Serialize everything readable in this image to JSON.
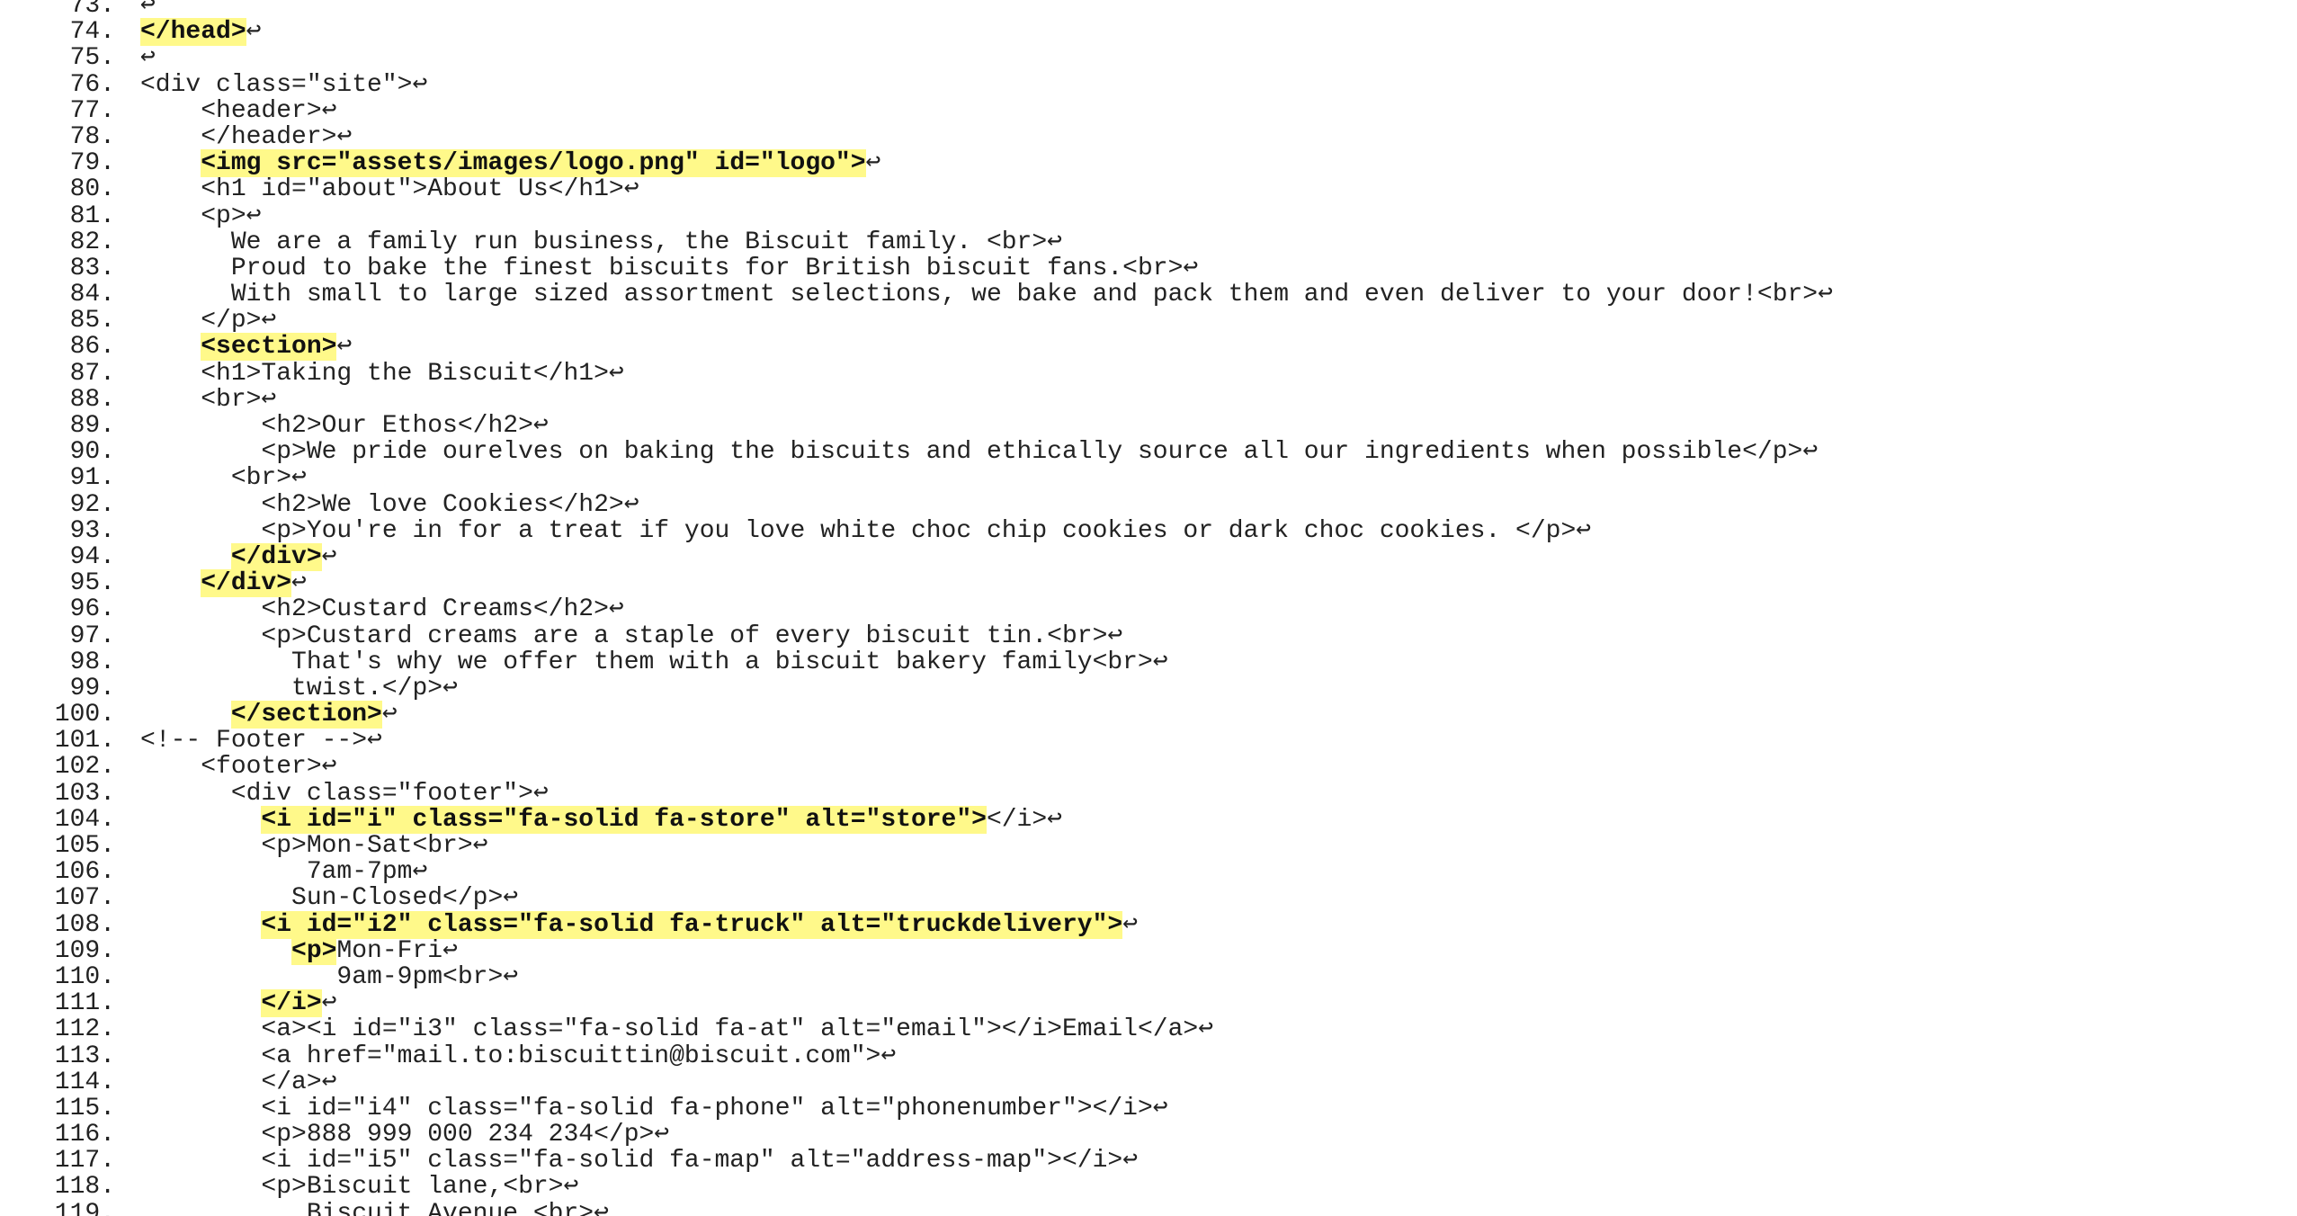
{
  "colors": {
    "background": "#ffffff",
    "text": "#222222",
    "highlight": "#fff98a"
  },
  "newline_marker": "↩",
  "lines": [
    {
      "num": "73.",
      "segments": [
        {
          "t": "",
          "hl": false
        }
      ]
    },
    {
      "num": "74.",
      "segments": [
        {
          "t": "</head>",
          "hl": true
        }
      ]
    },
    {
      "num": "75.",
      "segments": [
        {
          "t": "",
          "hl": false
        }
      ]
    },
    {
      "num": "76.",
      "segments": [
        {
          "t": "<div class=\"site\">",
          "hl": false
        }
      ]
    },
    {
      "num": "77.",
      "segments": [
        {
          "t": "    <header>",
          "hl": false
        }
      ]
    },
    {
      "num": "78.",
      "segments": [
        {
          "t": "    </header>",
          "hl": false
        }
      ]
    },
    {
      "num": "79.",
      "segments": [
        {
          "t": "    ",
          "hl": false
        },
        {
          "t": "<img src=\"assets/images/logo.png\" id=\"logo\">",
          "hl": true
        }
      ]
    },
    {
      "num": "80.",
      "segments": [
        {
          "t": "    <h1 id=\"about\">About Us</h1>",
          "hl": false
        }
      ]
    },
    {
      "num": "81.",
      "segments": [
        {
          "t": "    <p>",
          "hl": false
        }
      ]
    },
    {
      "num": "82.",
      "segments": [
        {
          "t": "      We are a family run business, the Biscuit family. <br>",
          "hl": false
        }
      ]
    },
    {
      "num": "83.",
      "segments": [
        {
          "t": "      Proud to bake the finest biscuits for British biscuit fans.<br>",
          "hl": false
        }
      ]
    },
    {
      "num": "84.",
      "segments": [
        {
          "t": "      With small to large sized assortment selections, we bake and pack them and even deliver to your door!<br>",
          "hl": false
        }
      ]
    },
    {
      "num": "85.",
      "segments": [
        {
          "t": "    </p>",
          "hl": false
        }
      ]
    },
    {
      "num": "86.",
      "segments": [
        {
          "t": "    ",
          "hl": false
        },
        {
          "t": "<section>",
          "hl": true
        }
      ]
    },
    {
      "num": "87.",
      "segments": [
        {
          "t": "    <h1>Taking the Biscuit</h1>",
          "hl": false
        }
      ]
    },
    {
      "num": "88.",
      "segments": [
        {
          "t": "    <br>",
          "hl": false
        }
      ]
    },
    {
      "num": "89.",
      "segments": [
        {
          "t": "        <h2>Our Ethos</h2>",
          "hl": false
        }
      ]
    },
    {
      "num": "90.",
      "segments": [
        {
          "t": "        <p>We pride ourelves on baking the biscuits and ethically source all our ingredients when possible</p>",
          "hl": false
        }
      ]
    },
    {
      "num": "91.",
      "segments": [
        {
          "t": "      <br>",
          "hl": false
        }
      ]
    },
    {
      "num": "92.",
      "segments": [
        {
          "t": "        <h2>We love Cookies</h2>",
          "hl": false
        }
      ]
    },
    {
      "num": "93.",
      "segments": [
        {
          "t": "        <p>You're in for a treat if you love white choc chip cookies or dark choc cookies. </p>",
          "hl": false
        }
      ]
    },
    {
      "num": "94.",
      "segments": [
        {
          "t": "      ",
          "hl": false
        },
        {
          "t": "</div>",
          "hl": true
        }
      ]
    },
    {
      "num": "95.",
      "segments": [
        {
          "t": "    ",
          "hl": false
        },
        {
          "t": "</div>",
          "hl": true
        }
      ]
    },
    {
      "num": "96.",
      "segments": [
        {
          "t": "        <h2>Custard Creams</h2>",
          "hl": false
        }
      ]
    },
    {
      "num": "97.",
      "segments": [
        {
          "t": "        <p>Custard creams are a staple of every biscuit tin.<br>",
          "hl": false
        }
      ]
    },
    {
      "num": "98.",
      "segments": [
        {
          "t": "          That's why we offer them with a biscuit bakery family<br>",
          "hl": false
        }
      ]
    },
    {
      "num": "99.",
      "segments": [
        {
          "t": "          twist.</p>",
          "hl": false
        }
      ]
    },
    {
      "num": "100.",
      "segments": [
        {
          "t": "      ",
          "hl": false
        },
        {
          "t": "</section>",
          "hl": true
        }
      ]
    },
    {
      "num": "101.",
      "segments": [
        {
          "t": "<!-- Footer -->",
          "hl": false
        }
      ]
    },
    {
      "num": "102.",
      "segments": [
        {
          "t": "    <footer>",
          "hl": false
        }
      ]
    },
    {
      "num": "103.",
      "segments": [
        {
          "t": "      <div class=\"footer\">",
          "hl": false
        }
      ]
    },
    {
      "num": "104.",
      "segments": [
        {
          "t": "        ",
          "hl": false
        },
        {
          "t": "<i id=\"i\" class=\"fa-solid fa-store\" alt=\"store\">",
          "hl": true
        },
        {
          "t": "</i>",
          "hl": false
        }
      ]
    },
    {
      "num": "105.",
      "segments": [
        {
          "t": "        <p>Mon-Sat<br>",
          "hl": false
        }
      ]
    },
    {
      "num": "106.",
      "segments": [
        {
          "t": "           7am-7pm",
          "hl": false
        }
      ]
    },
    {
      "num": "107.",
      "segments": [
        {
          "t": "          Sun-Closed</p>",
          "hl": false
        }
      ]
    },
    {
      "num": "108.",
      "segments": [
        {
          "t": "        ",
          "hl": false
        },
        {
          "t": "<i id=\"i2\" class=\"fa-solid fa-truck\" alt=\"truckdelivery\">",
          "hl": true
        }
      ]
    },
    {
      "num": "109.",
      "segments": [
        {
          "t": "          ",
          "hl": false
        },
        {
          "t": "<p>",
          "hl": true
        },
        {
          "t": "Mon-Fri",
          "hl": false
        }
      ]
    },
    {
      "num": "110.",
      "segments": [
        {
          "t": "             9am-9pm<br>",
          "hl": false
        }
      ]
    },
    {
      "num": "111.",
      "segments": [
        {
          "t": "        ",
          "hl": false
        },
        {
          "t": "</i>",
          "hl": true
        }
      ]
    },
    {
      "num": "112.",
      "segments": [
        {
          "t": "        <a><i id=\"i3\" class=\"fa-solid fa-at\" alt=\"email\"></i>Email</a>",
          "hl": false
        }
      ]
    },
    {
      "num": "113.",
      "segments": [
        {
          "t": "        <a href=\"mail.to:biscuittin@biscuit.com\">",
          "hl": false
        }
      ]
    },
    {
      "num": "114.",
      "segments": [
        {
          "t": "        </a>",
          "hl": false
        }
      ]
    },
    {
      "num": "115.",
      "segments": [
        {
          "t": "        <i id=\"i4\" class=\"fa-solid fa-phone\" alt=\"phonenumber\"></i>",
          "hl": false
        }
      ]
    },
    {
      "num": "116.",
      "segments": [
        {
          "t": "        <p>888 999 000 234 234</p>",
          "hl": false
        }
      ]
    },
    {
      "num": "117.",
      "segments": [
        {
          "t": "        <i id=\"i5\" class=\"fa-solid fa-map\" alt=\"address-map\"></i>",
          "hl": false
        }
      ]
    },
    {
      "num": "118.",
      "segments": [
        {
          "t": "        <p>Biscuit lane,<br>",
          "hl": false
        }
      ]
    },
    {
      "num": "119.",
      "segments": [
        {
          "t": "           Biscuit Avenue <br>",
          "hl": false
        }
      ]
    }
  ]
}
